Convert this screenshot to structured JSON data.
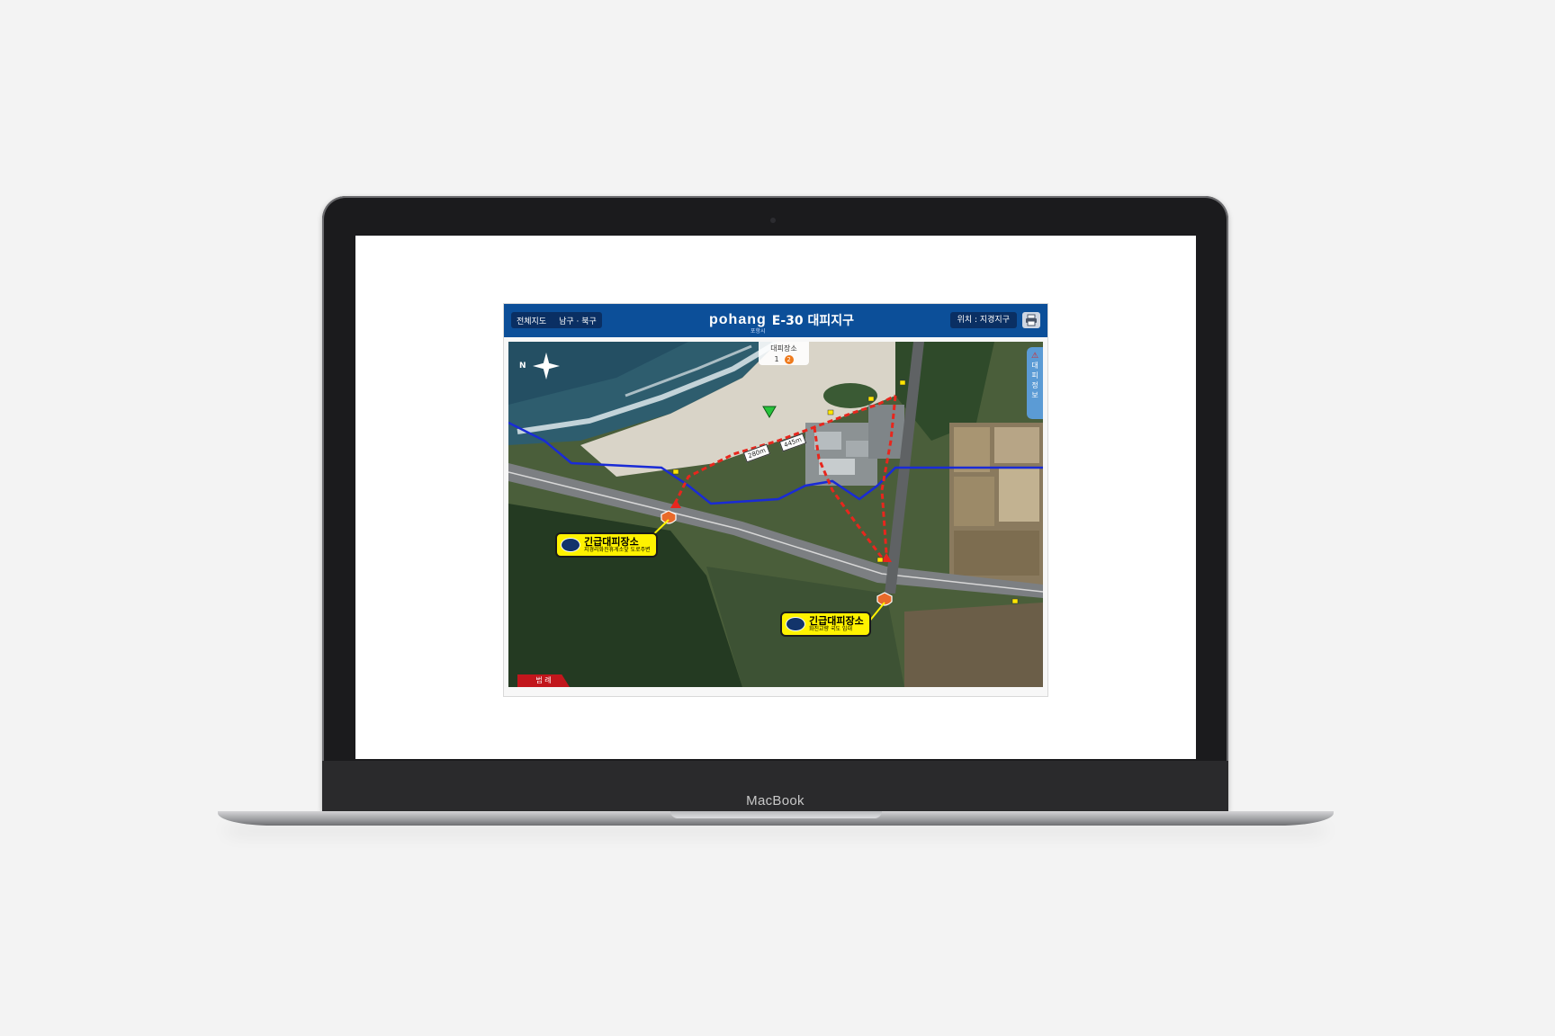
{
  "device": {
    "brand": "MacBook"
  },
  "app": {
    "nav": {
      "item1": "전체지도",
      "item2": "남구 · 북구"
    },
    "logo": "pohang",
    "logo_sub": "포항시",
    "title": "E-30 대피지구",
    "location": "위치 : 지경지구",
    "print_icon": "printer-icon"
  },
  "map": {
    "compass_label": "N",
    "shelter_tabs": {
      "title": "대피장소",
      "tab1": "1",
      "tab2": "2"
    },
    "side_tab": {
      "icon": "warning-icon",
      "label": "대피정보"
    },
    "distances": [
      "280m",
      "445m"
    ],
    "shelters": [
      {
        "name": "긴급대피장소",
        "detail": "지경리화진휴게소앞 도로주변"
      },
      {
        "name": "긴급대피장소",
        "detail": "화진교량 국도 입대"
      }
    ],
    "legend_label": "범 례",
    "colors": {
      "evac_route": "#e8261d",
      "boundary": "#1a2bd6",
      "header": "#0c4f99",
      "callout": "#fff200"
    }
  }
}
